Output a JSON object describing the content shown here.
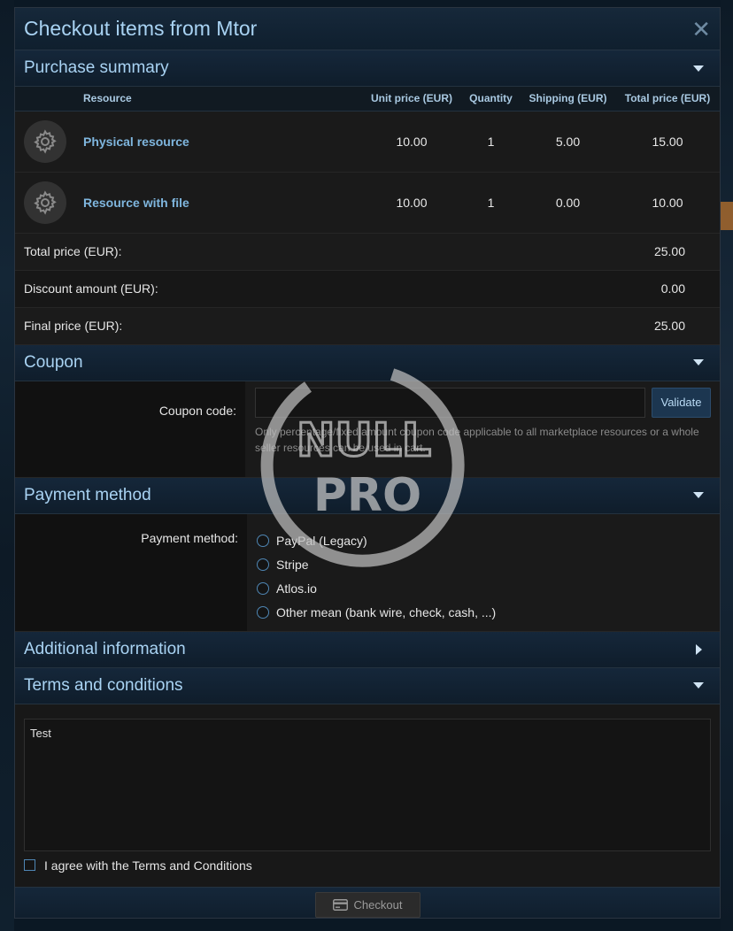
{
  "dialog": {
    "title": "Checkout items from Mtor",
    "close_symbol": "✕"
  },
  "purchase_summary": {
    "title": "Purchase summary",
    "columns": {
      "resource": "Resource",
      "unit_price": "Unit price (EUR)",
      "quantity": "Quantity",
      "shipping": "Shipping (EUR)",
      "total": "Total price (EUR)"
    },
    "items": [
      {
        "icon": "gear-icon",
        "name": "Physical resource",
        "unit_price": "10.00",
        "quantity": "1",
        "shipping": "5.00",
        "total": "15.00"
      },
      {
        "icon": "gear-icon",
        "name": "Resource with file",
        "unit_price": "10.00",
        "quantity": "1",
        "shipping": "0.00",
        "total": "10.00"
      }
    ],
    "totals": [
      {
        "label": "Total price (EUR):",
        "value": "25.00"
      },
      {
        "label": "Discount amount (EUR):",
        "value": "0.00"
      },
      {
        "label": "Final price (EUR):",
        "value": "25.00"
      }
    ]
  },
  "coupon": {
    "title": "Coupon",
    "label": "Coupon code:",
    "value": "",
    "placeholder": "",
    "validate_label": "Validate",
    "hint": "Only percentage/fixed amount coupon code applicable to all marketplace resources or a whole seller resources can be used in cart."
  },
  "payment": {
    "title": "Payment method",
    "label": "Payment method:",
    "options": [
      "PayPal (Legacy)",
      "Stripe",
      "Atlos.io",
      "Other mean (bank wire, check, cash, ...)"
    ]
  },
  "additional_info": {
    "title": "Additional information"
  },
  "terms": {
    "title": "Terms and conditions",
    "text": "Test",
    "agree_label": "I agree with the Terms and Conditions"
  },
  "footer": {
    "checkout_label": "Checkout"
  },
  "watermark": {
    "text_top": "NULL",
    "text_bottom": "PRO"
  },
  "colors": {
    "accent": "#a9d3f3",
    "link": "#7fb6de",
    "background": "#181818"
  }
}
